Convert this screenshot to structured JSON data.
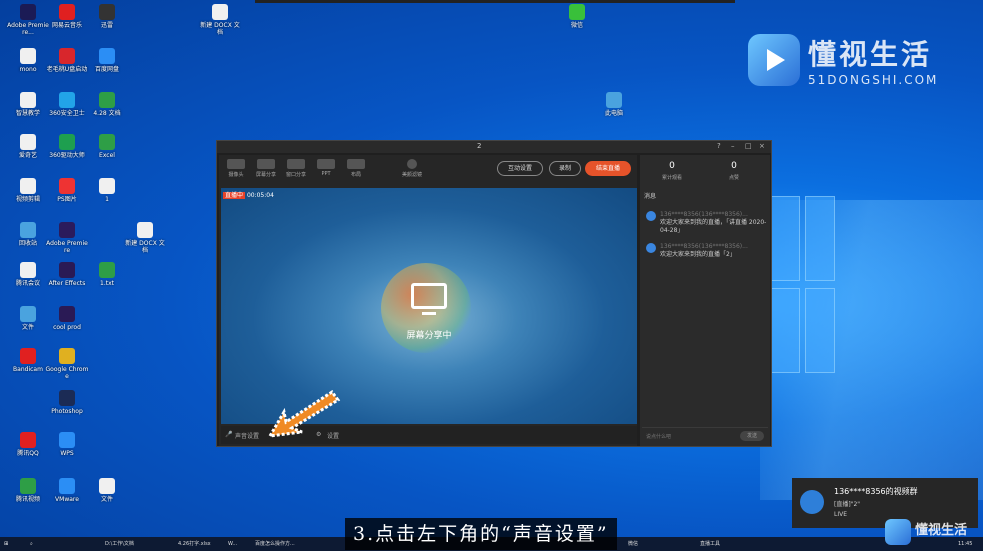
{
  "desktop": {
    "icons": [
      {
        "label": "Adobe Premiere...",
        "color": "#1b1b55"
      },
      {
        "label": "网易云音乐",
        "color": "#e02020"
      },
      {
        "label": "迅雷",
        "color": "#333"
      },
      {
        "label": "新建 DOCX 文档",
        "color": "#f0f0f0"
      },
      {
        "label": "微信",
        "color": "#39c03a"
      },
      {
        "label": "mono",
        "color": "#f0f0f0"
      },
      {
        "label": "老毛桃U盘启动",
        "color": "#d8262c"
      },
      {
        "label": "百度网盘",
        "color": "#2b8ef5"
      },
      {
        "label": "此电脑",
        "color": "#4aa3df"
      },
      {
        "label": "智慧教学",
        "color": "#f0f0f0"
      },
      {
        "label": "360安全卫士",
        "color": "#22a4e8"
      },
      {
        "label": "4.28 文档",
        "color": "#2e9e46"
      },
      {
        "label": "爱奇艺",
        "color": "#f0f0f0"
      },
      {
        "label": "360驱动大师",
        "color": "#1e9f4f"
      },
      {
        "label": "Excel",
        "color": "#2e9e46"
      },
      {
        "label": "视频剪辑",
        "color": "#f0f0f0"
      },
      {
        "label": "PS图片",
        "color": "#e33"
      },
      {
        "label": "1",
        "color": "#f0f0f0"
      },
      {
        "label": "回收站",
        "color": "#4aa3df"
      },
      {
        "label": "Adobe Premiere",
        "color": "#2b1b5c"
      },
      {
        "label": "新建 DOCX 文档",
        "color": "#f0f0f0"
      },
      {
        "label": "腾讯会议",
        "color": "#f0f0f0"
      },
      {
        "label": "After Effects",
        "color": "#2a1a55"
      },
      {
        "label": "1.txt",
        "color": "#2e9e46"
      },
      {
        "label": "文件",
        "color": "#4aa3df"
      },
      {
        "label": "cool prod",
        "color": "#2a1a55"
      },
      {
        "label": "Bandicam",
        "color": "#e02020"
      },
      {
        "label": "Google Chrome",
        "color": "#e0b020"
      },
      {
        "label": "Photoshop",
        "color": "#1b2b55"
      },
      {
        "label": "腾讯QQ",
        "color": "#e02020"
      },
      {
        "label": "WPS",
        "color": "#2b8ef5"
      },
      {
        "label": "腾讯视频",
        "color": "#2e9e46"
      },
      {
        "label": "VMware",
        "color": "#2b8ef5"
      },
      {
        "label": "文件",
        "color": "#f0f0f0"
      }
    ]
  },
  "watermark": {
    "title": "懂视生活",
    "subtitle": "51DONGSHI.COM",
    "small": "懂视生活"
  },
  "app": {
    "window_title": "2",
    "tools": [
      {
        "label": "摄像头"
      },
      {
        "label": "屏幕分享"
      },
      {
        "label": "窗口分享"
      },
      {
        "label": "PPT"
      },
      {
        "label": "布局"
      },
      {
        "label": "美颜滤镜"
      }
    ],
    "buttons": {
      "interact": "互动设置",
      "record": "录制",
      "start_live": "结束直播"
    },
    "live_badge": "直播中",
    "live_time": "00:05:04",
    "sharing_caption": "屏幕分享中",
    "sound_settings": "声音设置",
    "settings": "设置",
    "stats": [
      {
        "value": "0",
        "label": "累计观看"
      },
      {
        "value": "0",
        "label": "点赞"
      }
    ],
    "comments_header": "消息",
    "comments": [
      {
        "name": "136****8356(136****8356)...",
        "text": "欢迎大家来到我的直播，「讲直播 2020-04-28」"
      },
      {
        "name": "136****8356(136****8356)...",
        "text": "欢迎大家来到我的直播「2」"
      }
    ],
    "input_placeholder": "说点什么吧",
    "send": "发送"
  },
  "notification": {
    "title": "136****8356的视频群",
    "line1": "[直播]\"2\"",
    "line2": "LIVE"
  },
  "taskbar": {
    "items": [
      "D:\\工作\\文档",
      "4.26打字.xlsx",
      "W...",
      "百度怎么操作方...",
      "微信",
      "直播工具"
    ],
    "clock": "11:45"
  },
  "subtitle": "3.点击左下角的“声音设置”"
}
